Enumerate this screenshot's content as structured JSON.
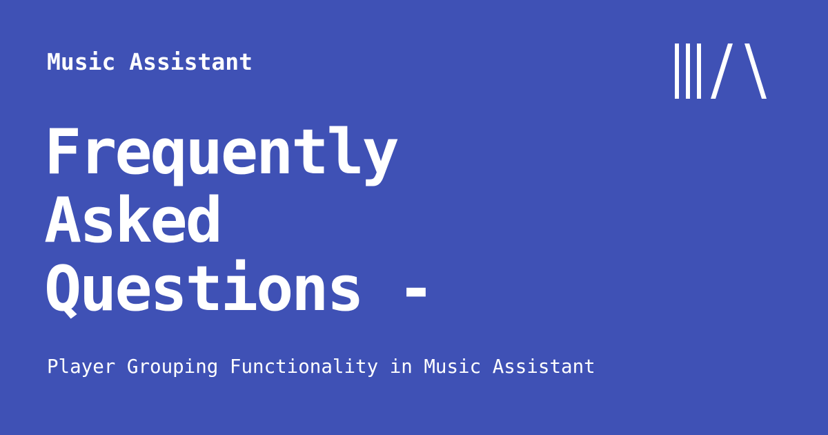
{
  "brand": {
    "name": "Music Assistant",
    "logo_icon": "music-assistant-logo-icon"
  },
  "title": {
    "lines": [
      "Frequently",
      "Asked",
      "Questions -"
    ]
  },
  "subtitle": "Player Grouping Functionality in Music Assistant",
  "colors": {
    "background": "#3f51b5",
    "foreground": "#ffffff"
  }
}
